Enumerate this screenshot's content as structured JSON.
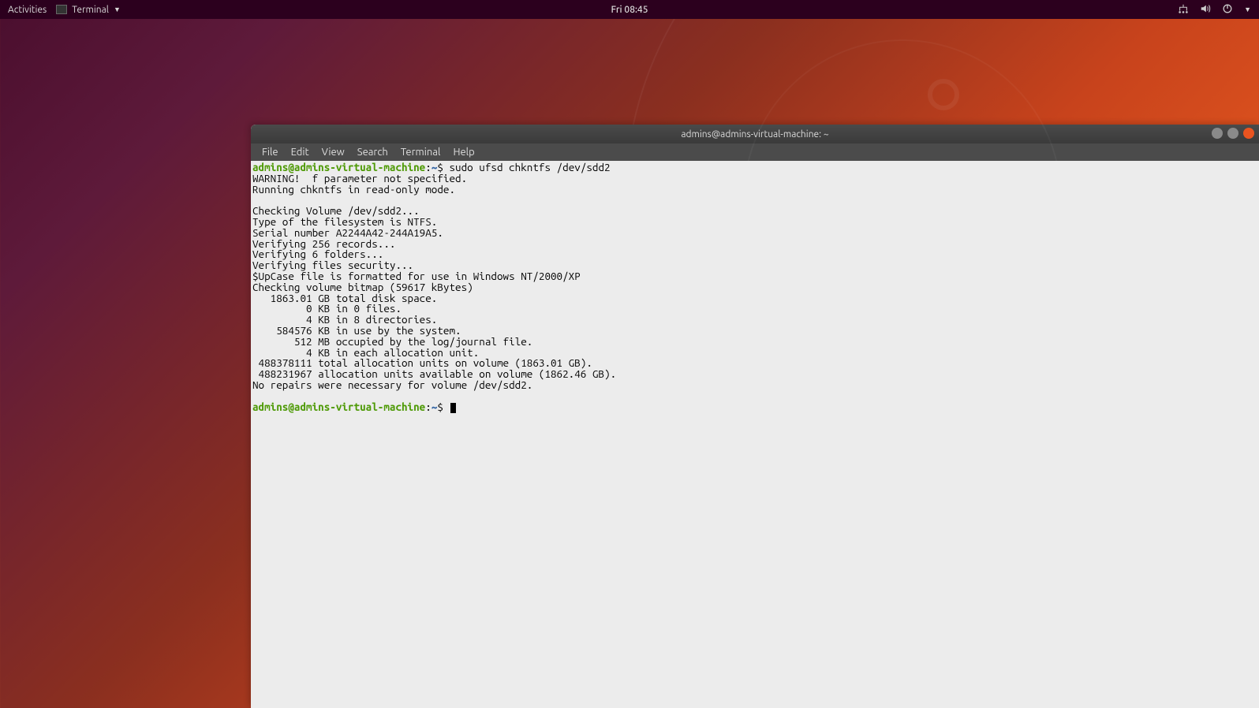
{
  "topbar": {
    "activities": "Activities",
    "app_name": "Terminal",
    "clock": "Fri 08:45"
  },
  "window": {
    "title": "admins@admins-virtual-machine: ~",
    "menu": {
      "file": "File",
      "edit": "Edit",
      "view": "View",
      "search": "Search",
      "terminal": "Terminal",
      "help": "Help"
    }
  },
  "terminal": {
    "prompt_user": "admins@admins-virtual-machine",
    "prompt_sep": ":",
    "prompt_path": "~",
    "prompt_sym": "$ ",
    "command": "sudo ufsd chkntfs /dev/sdd2",
    "output_lines": [
      "WARNING!  f parameter not specified.",
      "Running chkntfs in read-only mode.",
      "",
      "Checking Volume /dev/sdd2...",
      "Type of the filesystem is NTFS.",
      "Serial number A2244A42-244A19A5.",
      "Verifying 256 records...",
      "Verifying 6 folders...",
      "Verifying files security...",
      "$UpCase file is formatted for use in Windows NT/2000/XP",
      "Checking volume bitmap (59617 kBytes)",
      "   1863.01 GB total disk space.",
      "         0 KB in 0 files.",
      "         4 KB in 8 directories.",
      "    584576 KB in use by the system.",
      "       512 MB occupied by the log/journal file.",
      "         4 KB in each allocation unit.",
      " 488378111 total allocation units on volume (1863.01 GB).",
      " 488231967 allocation units available on volume (1862.46 GB).",
      "No repairs were necessary for volume /dev/sdd2."
    ]
  }
}
